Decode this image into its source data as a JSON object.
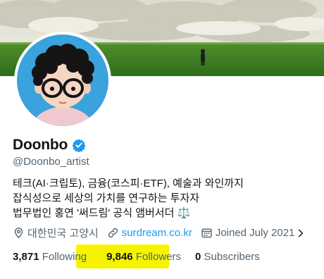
{
  "profile": {
    "display_name": "Doonbo",
    "handle": "@Doonbo_artist",
    "bio_lines": [
      "테크(AI·크립토), 금융(코스피·ETF), 예술과 와인까지",
      "잡식성으로 세상의 가치를 연구하는 투자자",
      "법무법인 홍연 '써드림' 공식 앰버서더 ⚖️"
    ],
    "location": "대한민국 고양시",
    "website": "surdream.co.kr",
    "joined": "Joined July 2021"
  },
  "stats": {
    "following_count": "3,871",
    "following_label": "Following",
    "followers_count": "9,846",
    "followers_label": "Followers",
    "subscribers_count": "0",
    "subscribers_label": "Subscribers"
  },
  "colors": {
    "accent": "#1d9bf0",
    "secondary_text": "#536471",
    "highlight": "#f6f300"
  },
  "icons": [
    "verified-badge-icon",
    "location-pin-icon",
    "link-icon",
    "calendar-icon",
    "chevron-right-icon"
  ]
}
